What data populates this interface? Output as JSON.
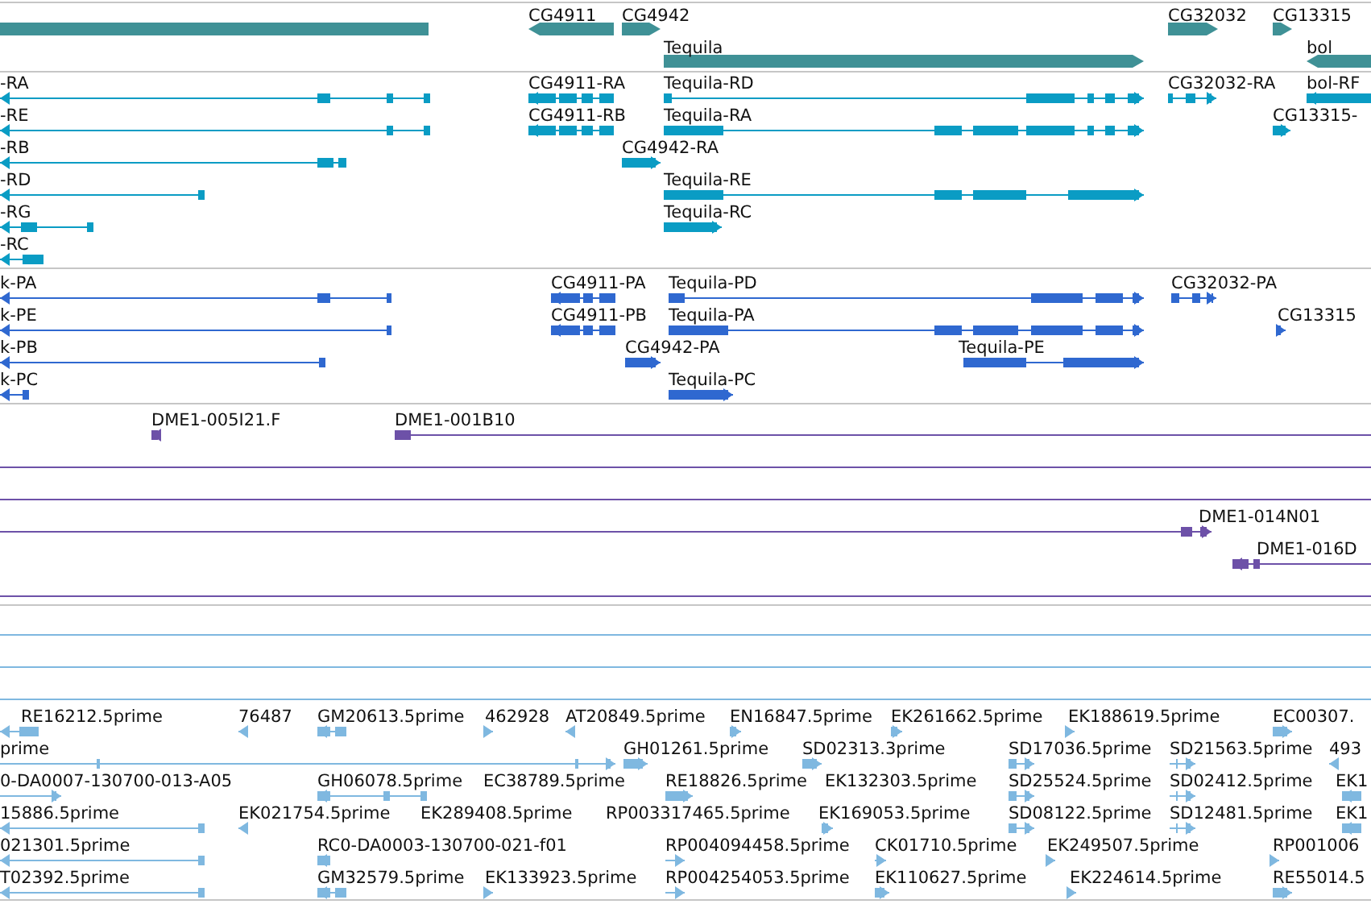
{
  "tracks": [
    {
      "kind": "gene",
      "color": "#3f9196",
      "rows": [
        {
          "features": [
            {
              "kind": "plain"
            },
            {
              "label": "CG4911",
              "kind": "leftward"
            },
            {
              "label": "CG4942",
              "kind": "rightward"
            },
            {
              "label": "CG32032",
              "kind": "rightward"
            },
            {
              "label": "CG13315",
              "kind": "rightward"
            }
          ]
        },
        {
          "features": [
            {
              "label": "Tequila",
              "kind": "rightward"
            },
            {
              "label": "bol",
              "kind": "leftward"
            }
          ]
        }
      ]
    },
    {
      "kind": "transcript",
      "color": "#0a9cc4",
      "rows": [
        {
          "features": [
            {
              "label": "-RA",
              "kind": "leftward"
            },
            {
              "label": "CG4911-RA",
              "kind": "leftward"
            },
            {
              "label": "Tequila-RD",
              "kind": "rightward"
            },
            {
              "label": "CG32032-RA",
              "kind": "rightward"
            },
            {
              "label": "bol-RF",
              "kind": "leftward"
            }
          ]
        },
        {
          "features": [
            {
              "label": "-RE",
              "kind": "leftward"
            },
            {
              "label": "CG4911-RB",
              "kind": "leftward"
            },
            {
              "label": "Tequila-RA",
              "kind": "rightward"
            },
            {
              "label": "CG13315-",
              "kind": "rightward"
            }
          ]
        },
        {
          "features": [
            {
              "label": "-RB",
              "kind": "leftward"
            },
            {
              "label": "CG4942-RA",
              "kind": "rightward"
            }
          ]
        },
        {
          "features": [
            {
              "label": "-RD",
              "kind": "leftward"
            },
            {
              "label": "Tequila-RE",
              "kind": "rightward"
            }
          ]
        },
        {
          "features": [
            {
              "label": "-RG",
              "kind": "leftward"
            },
            {
              "label": "Tequila-RC",
              "kind": "rightward"
            }
          ]
        },
        {
          "features": [
            {
              "label": "-RC",
              "kind": "leftward"
            }
          ]
        }
      ]
    },
    {
      "kind": "transcript",
      "color": "#2f68d0",
      "rows": [
        {
          "features": [
            {
              "label": "k-PA",
              "kind": "leftward"
            },
            {
              "label": "CG4911-PA",
              "kind": "leftward"
            },
            {
              "label": "Tequila-PD",
              "kind": "rightward"
            },
            {
              "label": "CG32032-PA",
              "kind": "rightward"
            }
          ]
        },
        {
          "features": [
            {
              "label": "k-PE",
              "kind": "leftward"
            },
            {
              "label": "CG4911-PB",
              "kind": "leftward"
            },
            {
              "label": "Tequila-PA",
              "kind": "rightward"
            },
            {
              "label": "CG13315",
              "kind": "rightward"
            }
          ]
        },
        {
          "features": [
            {
              "label": "k-PB",
              "kind": "leftward"
            },
            {
              "label": "CG4942-PA",
              "kind": "rightward"
            },
            {
              "label": "Tequila-PE",
              "kind": "rightward"
            }
          ]
        },
        {
          "features": [
            {
              "label": "k-PC",
              "kind": "leftward"
            },
            {
              "label": "Tequila-PC",
              "kind": "rightward"
            }
          ]
        }
      ]
    },
    {
      "kind": "transcript",
      "color": "#6d51a8",
      "rows": [
        {
          "features": [
            {
              "label": "DME1-005I21.F",
              "kind": "leftward"
            },
            {
              "label": "DME1-001B10",
              "kind": "plain"
            }
          ]
        },
        {
          "features": [
            {
              "kind": "plain"
            }
          ]
        },
        {
          "features": [
            {
              "kind": "plain"
            }
          ]
        },
        {
          "features": [
            {
              "label": "DME1-014N01",
              "kind": "rightward"
            }
          ]
        },
        {
          "features": [
            {
              "label": "DME1-016D",
              "kind": "leftward"
            }
          ]
        },
        {
          "features": [
            {
              "kind": "plain"
            }
          ]
        }
      ]
    },
    {
      "kind": "transcript",
      "color": "#7fb8e0",
      "rows": [
        {
          "features": [
            {
              "kind": "plain"
            }
          ]
        },
        {
          "features": [
            {
              "kind": "plain"
            }
          ]
        },
        {
          "features": [
            {
              "kind": "plain"
            }
          ]
        },
        {
          "features": [
            {
              "label": "RE16212.5prime",
              "kind": "leftward"
            },
            {
              "label": "76487",
              "kind": "leftward"
            },
            {
              "label": "GM20613.5prime",
              "kind": "leftward"
            },
            {
              "label": "462928",
              "kind": "rightward"
            },
            {
              "label": "AT20849.5prime",
              "kind": "leftward"
            },
            {
              "label": "EN16847.5prime",
              "kind": "rightward"
            },
            {
              "label": "EK261662.5prime",
              "kind": "rightward"
            },
            {
              "label": "EK188619.5prime",
              "kind": "rightward"
            },
            {
              "label": "EC00307.",
              "kind": "rightward"
            }
          ]
        },
        {
          "features": [
            {
              "label": "prime",
              "kind": "rightward"
            },
            {
              "label": "GH01261.5prime",
              "kind": "rightward"
            },
            {
              "label": "SD02313.3prime",
              "kind": "rightward"
            },
            {
              "label": "SD17036.5prime",
              "kind": "rightward"
            },
            {
              "label": "SD21563.5prime",
              "kind": "rightward"
            },
            {
              "label": "493",
              "kind": "leftward"
            }
          ]
        },
        {
          "features": [
            {
              "label": "0-DA0007-130700-013-A05",
              "kind": "rightward"
            },
            {
              "label": "GH06078.5prime",
              "kind": "leftward"
            },
            {
              "label": "EC38789.5prime"
            },
            {
              "label": "RE18826.5prime",
              "kind": "rightward"
            },
            {
              "label": "EK132303.5prime"
            },
            {
              "label": "SD25524.5prime",
              "kind": "rightward"
            },
            {
              "label": "SD02412.5prime",
              "kind": "rightward"
            },
            {
              "label": "EK1",
              "kind": "leftward"
            }
          ]
        },
        {
          "features": [
            {
              "label": "15886.5prime",
              "kind": "leftward"
            },
            {
              "label": "EK021754.5prime",
              "kind": "leftward"
            },
            {
              "label": "EK289408.5prime"
            },
            {
              "label": "RP003317465.5prime"
            },
            {
              "label": "EK169053.5prime",
              "kind": "rightward"
            },
            {
              "label": "SD08122.5prime",
              "kind": "rightward"
            },
            {
              "label": "SD12481.5prime",
              "kind": "rightward"
            },
            {
              "label": "EK1",
              "kind": "leftward"
            }
          ]
        },
        {
          "features": [
            {
              "label": "021301.5prime",
              "kind": "leftward"
            },
            {
              "label": "RC0-DA0003-130700-021-f01",
              "kind": "leftward"
            },
            {
              "label": "RP004094458.5prime",
              "kind": "rightward"
            },
            {
              "label": "CK01710.5prime",
              "kind": "rightward"
            },
            {
              "label": "EK249507.5prime",
              "kind": "rightward"
            },
            {
              "label": "RP001006",
              "kind": "rightward"
            }
          ]
        },
        {
          "features": [
            {
              "label": "T02392.5prime",
              "kind": "leftward"
            },
            {
              "label": "GM32579.5prime",
              "kind": "leftward"
            },
            {
              "label": "EK133923.5prime",
              "kind": "rightward"
            },
            {
              "label": "RP004254053.5prime",
              "kind": "rightward"
            },
            {
              "label": "EK110627.5prime",
              "kind": "rightward"
            },
            {
              "label": "EK224614.5prime",
              "kind": "rightward"
            },
            {
              "label": "RE55014.5",
              "kind": "rightward"
            }
          ]
        }
      ]
    }
  ]
}
